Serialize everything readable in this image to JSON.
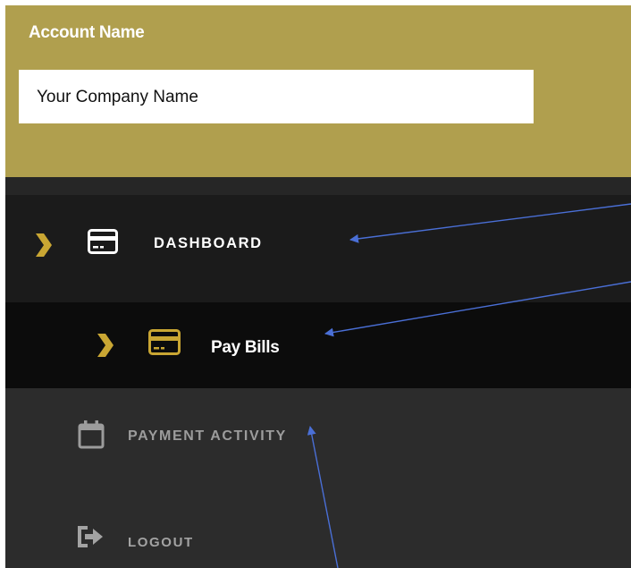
{
  "header": {
    "account_label": "Account Name",
    "company_name": "Your Company Name"
  },
  "menu": {
    "items": [
      {
        "label": "DASHBOARD",
        "icon": "credit-card-icon",
        "chevron": "chevron-right-icon"
      },
      {
        "label": "Pay Bills",
        "icon": "credit-card-icon",
        "chevron": "chevron-right-icon"
      },
      {
        "label": "PAYMENT ACTIVITY",
        "icon": "calendar-icon"
      },
      {
        "label": "LOGOUT",
        "icon": "logout-icon"
      }
    ]
  },
  "colors": {
    "header_bg": "#b09f4e",
    "accent_gold": "#c9a633",
    "menu_dark": "#1b1b1b",
    "submenu_dark": "#0c0c0c",
    "menu_gray": "#2c2c2c",
    "annotation_arrow": "#4a6fd6"
  }
}
